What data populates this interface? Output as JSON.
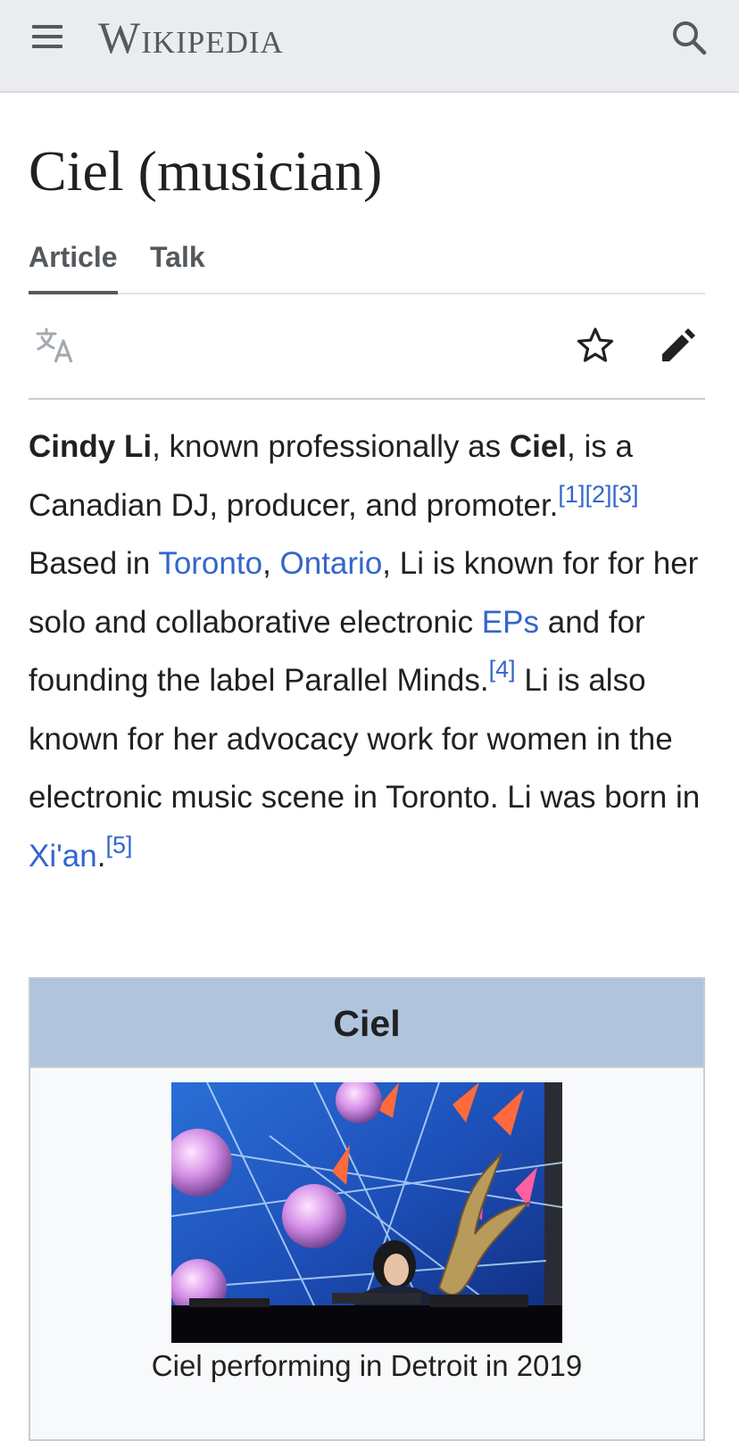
{
  "header": {
    "wordmark": "Wikipedia",
    "menu_icon": "hamburger-menu-icon",
    "search_icon": "search-icon",
    "background": "#eaecf0"
  },
  "page": {
    "title": "Ciel (musician)",
    "tabs": [
      {
        "label": "Article",
        "active": true
      },
      {
        "label": "Talk",
        "active": false
      }
    ],
    "actions": {
      "language_icon": "translate-icon",
      "watch_icon": "star-icon",
      "edit_icon": "pencil-icon"
    }
  },
  "lead": {
    "name": "Cindy Li",
    "t1": ", known professionally as ",
    "alias": "Ciel",
    "t2": ", is a Canadian DJ, producer, and promoter.",
    "ref1": "[1]",
    "ref2": "[2]",
    "ref3": "[3]",
    "t3": " Based in ",
    "link_toronto": "Toronto",
    "t4": ", ",
    "link_ontario": "Ontario",
    "t5": ", Li is known for for her solo and collaborative electronic ",
    "link_eps": "EPs",
    "t6": " and for founding the label Parallel Minds.",
    "ref4": "[4]",
    "t7": " Li is also known for her advocacy work for women in the electronic music scene in Toronto. Li was born in ",
    "link_xian": "Xi'an",
    "t8": ".",
    "ref5": "[5]"
  },
  "infobox": {
    "title": "Ciel",
    "caption": "Ciel performing in Detroit in 2019",
    "header_color": "#b0c4de"
  },
  "colors": {
    "link": "#3366cc",
    "text": "#202122",
    "icon": "#54595d"
  }
}
